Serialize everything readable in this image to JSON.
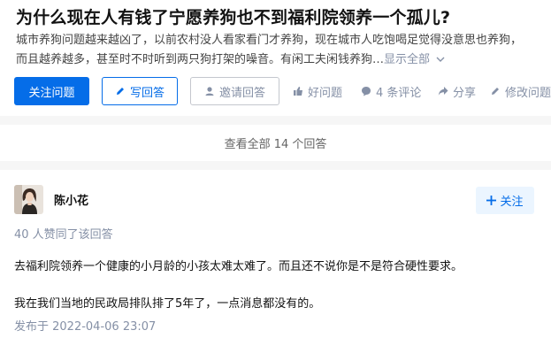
{
  "question": {
    "title": "为什么现在人有钱了宁愿养狗也不到福利院领养一个孤儿?",
    "excerpt_line1": "城市养狗问题越来越凶了，以前农村没人看家看门才养狗，现在城市人吃饱喝足觉得没意思也养狗，",
    "excerpt_line2": "而且越养越多，甚至时不时听到两只狗打架的噪音。有闲工夫闲钱养狗…",
    "show_all": "显示全部",
    "follow_label": "关注问题",
    "write_label": "写回答",
    "invite_label": "邀请回答",
    "good_label": "好问题",
    "comments_label": "4 条评论",
    "share_label": "分享",
    "edit_label": "修改问题"
  },
  "view_all_label": "查看全部 14 个回答",
  "answer": {
    "author": "陈小花",
    "follow_label": "关注",
    "voters": "40 人赞同了该回答",
    "paragraphs": [
      "去福利院领养一个健康的小月龄的小孩太难太难了。而且还不说你是不是符合硬性要求。",
      "我在我们当地的民政局排队排了5年了，一点消息都没有的。"
    ],
    "published": "发布于 2022-04-06 23:07"
  },
  "colors": {
    "brand_blue": "#056de8",
    "meta_gray": "#8590a6",
    "background": "#f6f6f6"
  },
  "icons": {
    "write": "pencil-icon",
    "invite": "person-icon",
    "good": "thumbs-up-icon",
    "comment": "comment-bubble-icon",
    "share": "share-icon",
    "edit": "pencil-icon",
    "more": "chevron-down-icon",
    "follow": "plus-icon"
  }
}
